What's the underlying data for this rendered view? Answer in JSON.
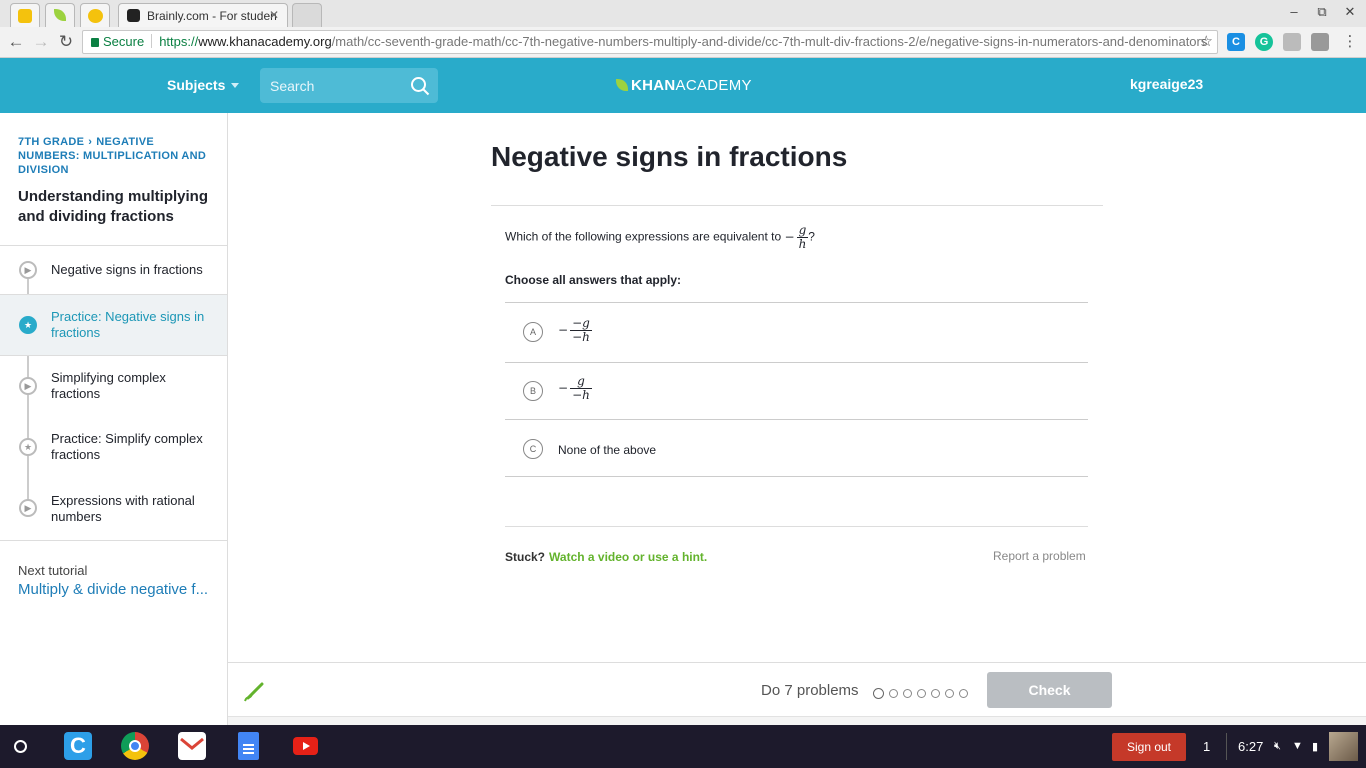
{
  "browser": {
    "tabs": [
      {
        "title": "",
        "icon": "classroom-icon"
      },
      {
        "title": "",
        "icon": "khan-leaf-icon"
      },
      {
        "title": "",
        "icon": "emoji-icon"
      },
      {
        "title": "Brainly.com - For studen",
        "icon": "brainly-icon"
      }
    ],
    "window_controls": {
      "minimize": "–",
      "restore": "⧉",
      "close": "✕"
    },
    "address": {
      "secure_label": "Secure",
      "url_scheme": "https://",
      "url_host": "www.khanacademy.org",
      "url_path": "/math/cc-seventh-grade-math/cc-7th-negative-numbers-multiply-and-divide/cc-7th-mult-div-fractions-2/e/negative-signs-in-numerators-and-denominators"
    },
    "extensions": [
      "c-extension-icon",
      "grammarly-icon",
      "shield-extension-icon",
      "profile-extension-icon",
      "menu-icon"
    ]
  },
  "header": {
    "subjects_label": "Subjects",
    "search_placeholder": "Search",
    "logo_bold": "KHAN",
    "logo_light": "ACADEMY",
    "username": "kgreaige23"
  },
  "sidebar": {
    "breadcrumb_grade": "7TH GRADE",
    "breadcrumb_unit": "NEGATIVE NUMBERS: MULTIPLICATION AND DIVISION",
    "tutorial_title": "Understanding multiplying and dividing fractions",
    "items": [
      {
        "label": "Negative signs in fractions",
        "type": "video",
        "active": false
      },
      {
        "label": "Practice: Negative signs in fractions",
        "type": "practice",
        "active": true
      },
      {
        "label": "Simplifying complex fractions",
        "type": "video",
        "active": false
      },
      {
        "label": "Practice: Simplify complex fractions",
        "type": "practice",
        "active": false
      },
      {
        "label": "Expressions with rational numbers",
        "type": "video",
        "active": false
      }
    ],
    "next_label": "Next tutorial",
    "next_link": "Multiply & divide negative f..."
  },
  "exercise": {
    "title": "Negative signs in fractions",
    "question_text": "Which of the following expressions are equivalent to",
    "question_expr": {
      "sign": "−",
      "num": "g",
      "den": "h",
      "suffix": "?"
    },
    "choose_text": "Choose all answers that apply:",
    "choices": [
      {
        "letter": "A",
        "sign": "−",
        "num": "−g",
        "den": "−h"
      },
      {
        "letter": "B",
        "sign": "−",
        "num": "g",
        "den": "−h"
      },
      {
        "letter": "C",
        "text": "None of the above"
      }
    ],
    "stuck_label": "Stuck?",
    "hint_link": "Watch a video or use a hint.",
    "report_link": "Report a problem"
  },
  "footer": {
    "do_problems": "Do 7 problems",
    "problem_count": 7,
    "check_label": "Check"
  },
  "taskbar": {
    "apps": [
      "launcher-icon",
      "c-app-icon",
      "chrome-icon",
      "gmail-icon",
      "docs-icon",
      "youtube-icon"
    ],
    "sign_out": "Sign out",
    "notification_count": "1",
    "time": "6:27"
  },
  "colors": {
    "ka_blue": "#29abca",
    "active_bg": "#eef2f4",
    "link_blue": "#1e7db7",
    "hint_green": "#63b32d",
    "check_disabled": "#babec2",
    "sign_out_red": "#c53929"
  }
}
